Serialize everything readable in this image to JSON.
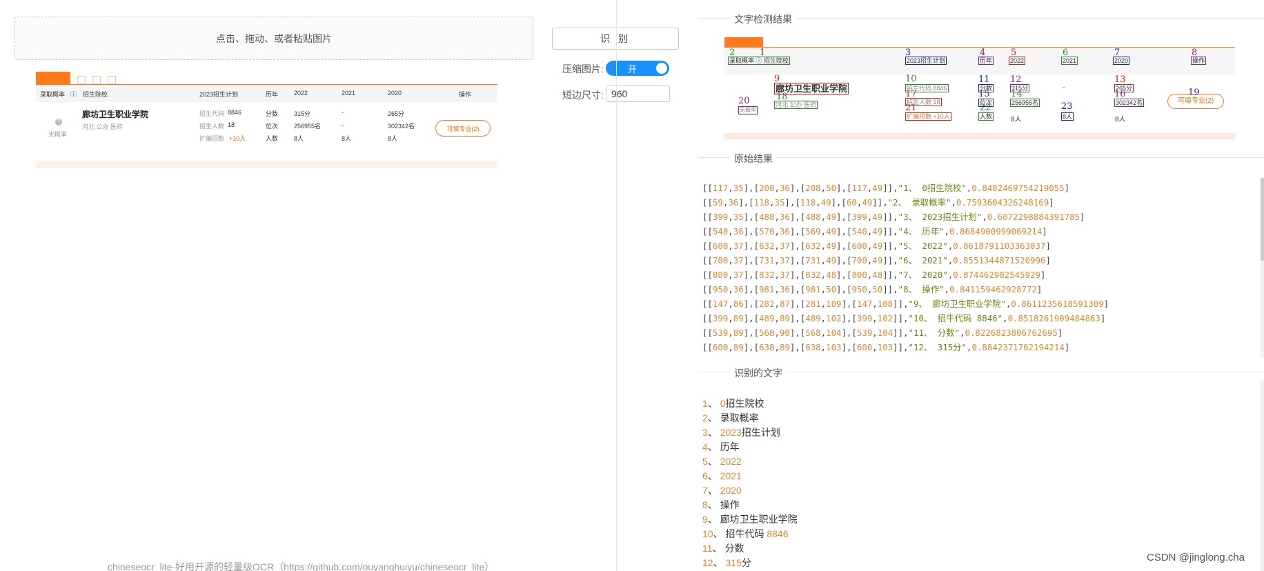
{
  "upload": {
    "text": "点击、拖动、或者粘贴图片"
  },
  "recognize_button": "识 别",
  "options": {
    "compress_label": "压缩图片:",
    "compress_value": "开",
    "compress_on": true,
    "short_side_label": "短边尺寸:",
    "short_side_value": "960"
  },
  "preview": {
    "header": [
      "录取概率",
      "招生院校",
      "2023招生计划",
      "历年",
      "2022",
      "2021",
      "2020",
      "操作"
    ],
    "row": {
      "probability": "无概率",
      "school": "廊坊卫生职业学院",
      "tags": "河北  公办  医药",
      "code_label": "招生代码",
      "code_value": "8846",
      "count_label": "招生人数",
      "count_value": "18",
      "expand_label": "扩编招数",
      "expand_value": "+10人",
      "kind": [
        "分数",
        "位次",
        "人数"
      ],
      "y2022": [
        "315分",
        "256955名",
        "8人"
      ],
      "y2021": [
        "-",
        "-",
        "8人"
      ],
      "y2020": [
        "265分",
        "302342名",
        "8人"
      ],
      "action": "可填专业(2)"
    }
  },
  "footer": "chineseocr_lite-好用开源的轻量级OCR（https://github.com/ouyanghuiyu/chineseocr_lite）",
  "detection": {
    "title": "文字检测结果",
    "header_boxes": [
      "录取概率 ⓘ  招生院校",
      "2023招生计划",
      "历年",
      "2022",
      "2021",
      "2020",
      "操作"
    ],
    "row_boxes": {
      "school": "廊坊卫生职业学院",
      "tags": "河北  公办  医药",
      "probability": "无概率",
      "code": "招生代码  8846",
      "count": "招生人数  18",
      "expand": "扩编招数  +10人",
      "score": "分数",
      "rank": "位次",
      "people": "人数",
      "s2022": "315分",
      "r2022": "256955名",
      "p2022": "8人",
      "dash": "-",
      "p2021": "8人",
      "s2020": "265分",
      "r2020": "302342名",
      "p2020": "8人",
      "action": "可填专业(2)"
    },
    "numbers": [
      "1",
      "2",
      "3",
      "4",
      "5",
      "6",
      "7",
      "8",
      "9",
      "10",
      "11",
      "12",
      "13",
      "14",
      "15",
      "16",
      "17",
      "18",
      "19",
      "20",
      "21",
      "22",
      "23"
    ]
  },
  "raw": {
    "title": "原始结果",
    "lines": [
      {
        "coords": "[[117,35],[208,36],[208,50],[117,49]]",
        "text": "\"1、 0招生院校\"",
        "score": "0.8402469754219055"
      },
      {
        "coords": "[[59,36],[118,35],[118,49],[60,49]]",
        "text": "\"2、 录取概率\"",
        "score": "0.7593604326248169"
      },
      {
        "coords": "[[399,35],[488,36],[488,49],[399,49]]",
        "text": "\"3、 2023招生计划\"",
        "score": "0.6072298884391785"
      },
      {
        "coords": "[[540,36],[570,36],[569,49],[540,49]]",
        "text": "\"4、 历年\"",
        "score": "0.8684900999069214"
      },
      {
        "coords": "[[600,37],[632,37],[632,49],[600,49]]",
        "text": "\"5、 2022\"",
        "score": "0.8618791103363037"
      },
      {
        "coords": "[[700,37],[731,37],[731,49],[700,49]]",
        "text": "\"6、 2021\"",
        "score": "0.8551344871520996"
      },
      {
        "coords": "[[800,37],[832,37],[832,48],[800,48]]",
        "text": "\"7、 2020\"",
        "score": "0.874462902545929"
      },
      {
        "coords": "[[950,36],[981,36],[981,50],[950,50]]",
        "text": "\"8、 操作\"",
        "score": "0.841159462928772"
      },
      {
        "coords": "[[147,86],[282,87],[281,109],[147,108]]",
        "text": "\"9、 廊坊卫生职业学院\"",
        "score": "0.8611235618591309"
      },
      {
        "coords": "[[399,89],[489,89],[489,102],[399,102]]",
        "text": "\"10、 招牛代码 8846\"",
        "score": "0.8518261909484863"
      },
      {
        "coords": "[[539,89],[568,90],[568,104],[539,104]]",
        "text": "\"11、 分数\"",
        "score": "0.8226823806762695"
      },
      {
        "coords": "[[600,89],[638,89],[638,103],[600,103]]",
        "text": "\"12、 315分\"",
        "score": "0.8842371702194214"
      }
    ]
  },
  "recognized": {
    "title": "识别的文字",
    "items": [
      {
        "idx": "1",
        "text": "0招生院校"
      },
      {
        "idx": "2",
        "text": "录取概率"
      },
      {
        "idx": "3",
        "text": "2023招生计划"
      },
      {
        "idx": "4",
        "text": "历年"
      },
      {
        "idx": "5",
        "text": "2022"
      },
      {
        "idx": "6",
        "text": "2021"
      },
      {
        "idx": "7",
        "text": "2020"
      },
      {
        "idx": "8",
        "text": "操作"
      },
      {
        "idx": "9",
        "text": "廊坊卫生职业学院"
      },
      {
        "idx": "10",
        "text": "招牛代码 8846"
      },
      {
        "idx": "11",
        "text": "分数"
      },
      {
        "idx": "12",
        "text": "315分"
      }
    ]
  },
  "watermark": "CSDN @jinglong.cha",
  "colors": {
    "accent": "#1890ff",
    "orange": "#ff7a1a",
    "number": "#e8862a",
    "string": "#6a8a10"
  }
}
